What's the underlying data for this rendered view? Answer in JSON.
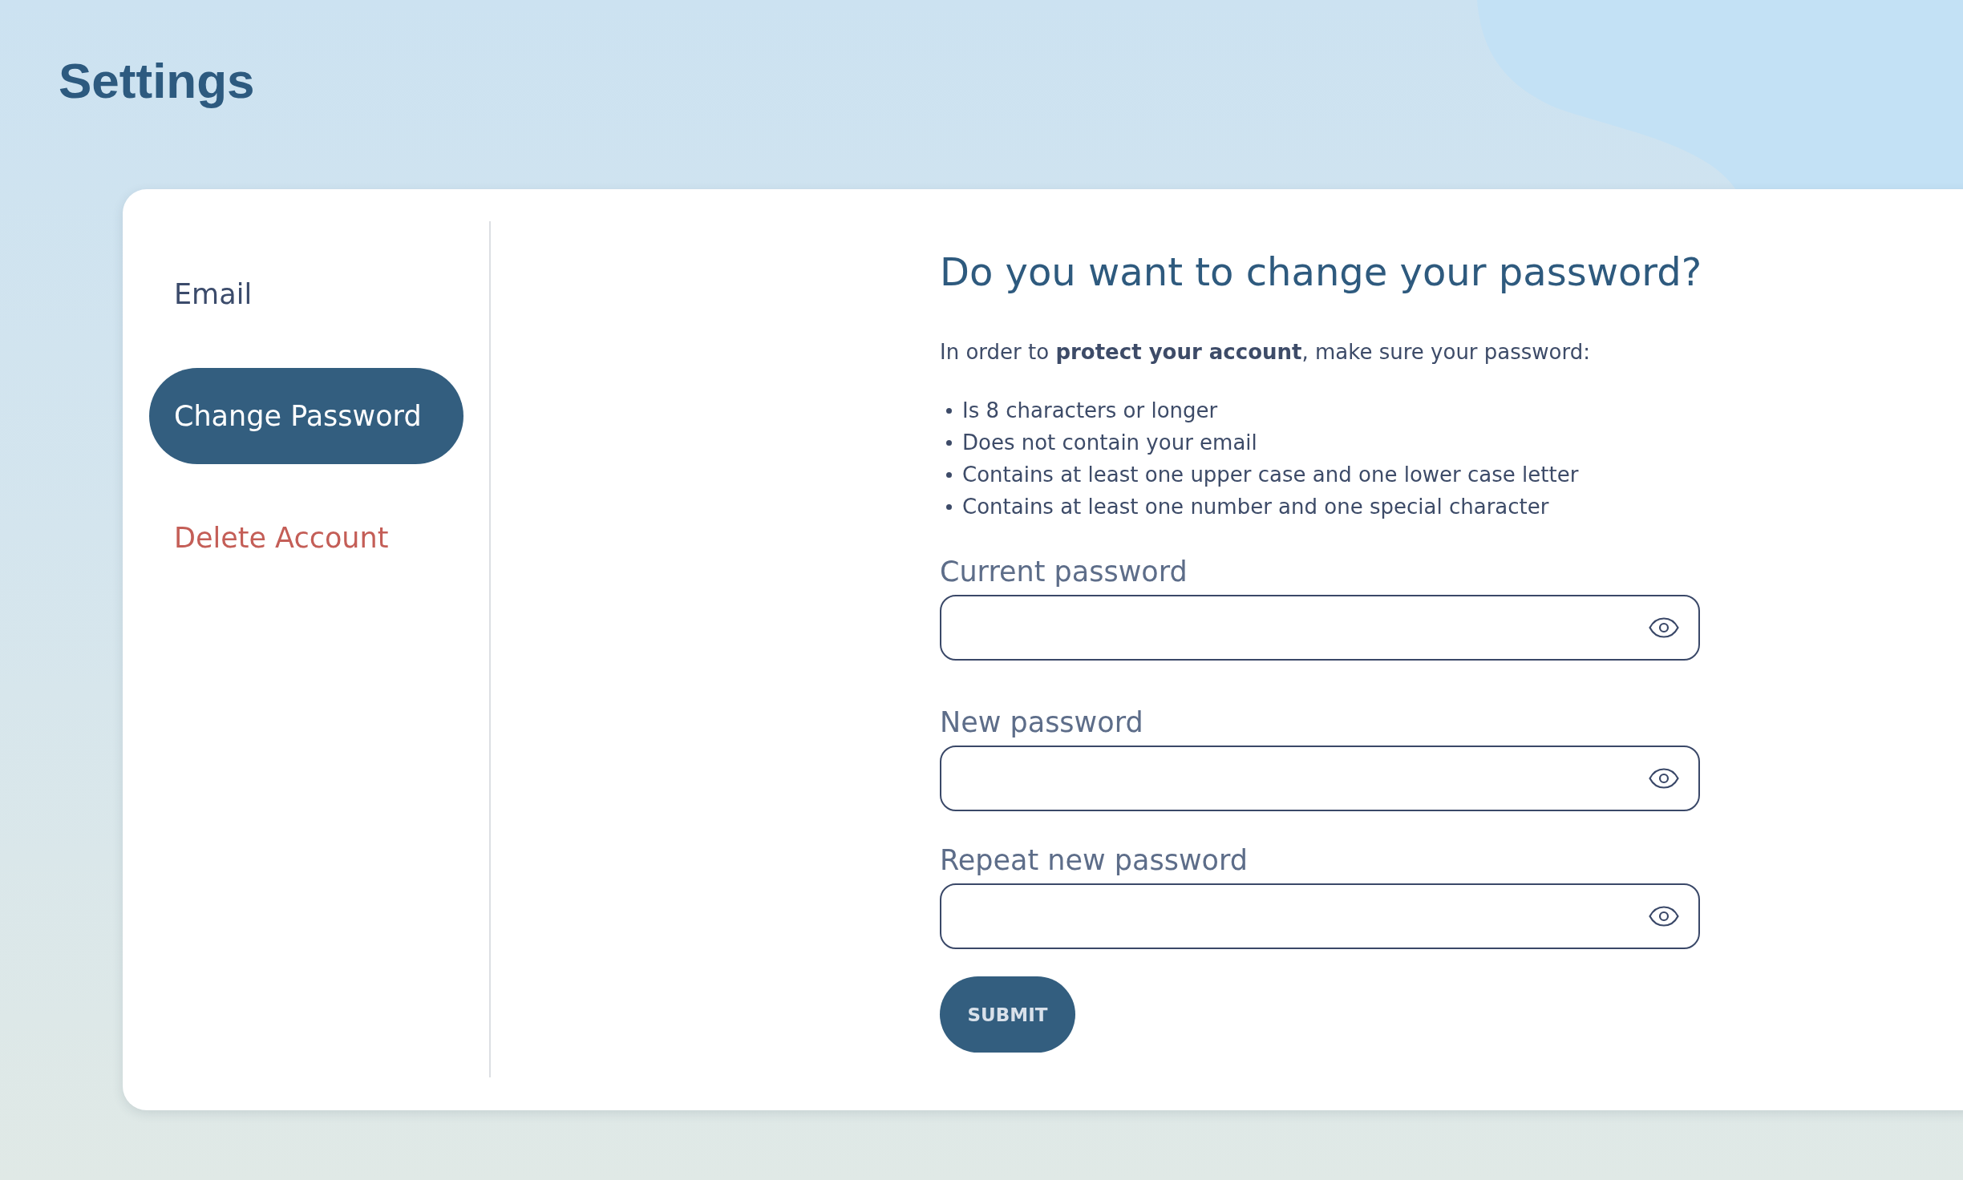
{
  "page": {
    "title": "Settings"
  },
  "sidebar": {
    "items": [
      {
        "label": "Email",
        "selected": false,
        "kind": "normal"
      },
      {
        "label": "Change Password",
        "selected": true,
        "kind": "normal"
      },
      {
        "label": "Delete Account",
        "selected": false,
        "kind": "danger"
      }
    ]
  },
  "form": {
    "heading": "Do you want to change your password?",
    "intro": "In order to **protect your account**, make sure your password:",
    "rules": [
      "Is 8 characters or longer",
      "Does not contain your email",
      "Contains at least one upper case and one lower case letter",
      "Contains at least one number and one special character"
    ],
    "fields": [
      {
        "label": "Current password"
      },
      {
        "label": "New password"
      },
      {
        "label": "Repeat new password"
      }
    ],
    "submit": "SUBMIT"
  }
}
